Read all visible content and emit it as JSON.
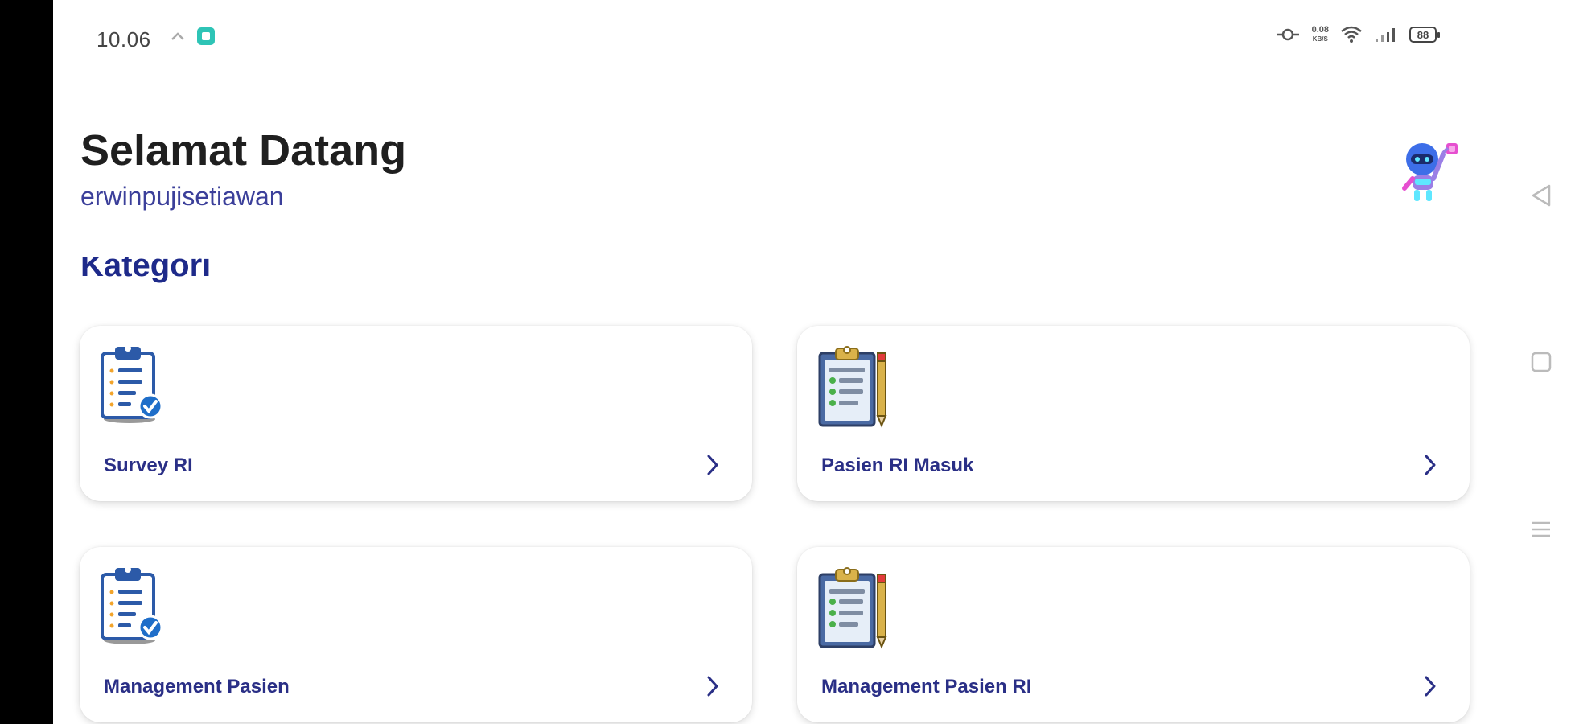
{
  "status_bar": {
    "time": "10.06",
    "net_speed_top": "0.08",
    "net_speed_bottom": "KB/S",
    "battery": "88"
  },
  "header": {
    "title": "Selamat Datang",
    "username": "erwinpujisetiawan"
  },
  "section": {
    "title": "Kategori"
  },
  "cards": [
    {
      "label": "Survey RI",
      "icon": "clipboard-check-icon"
    },
    {
      "label": "Pasien RI Masuk",
      "icon": "clipboard-pencil-icon"
    },
    {
      "label": "Management Pasien",
      "icon": "clipboard-check-icon"
    },
    {
      "label": "Management Pasien RI",
      "icon": "clipboard-pencil-icon"
    }
  ],
  "colors": {
    "title_text": "#1f1f1f",
    "accent_blue": "#2a2f86",
    "username_text": "#3b3f9a"
  }
}
